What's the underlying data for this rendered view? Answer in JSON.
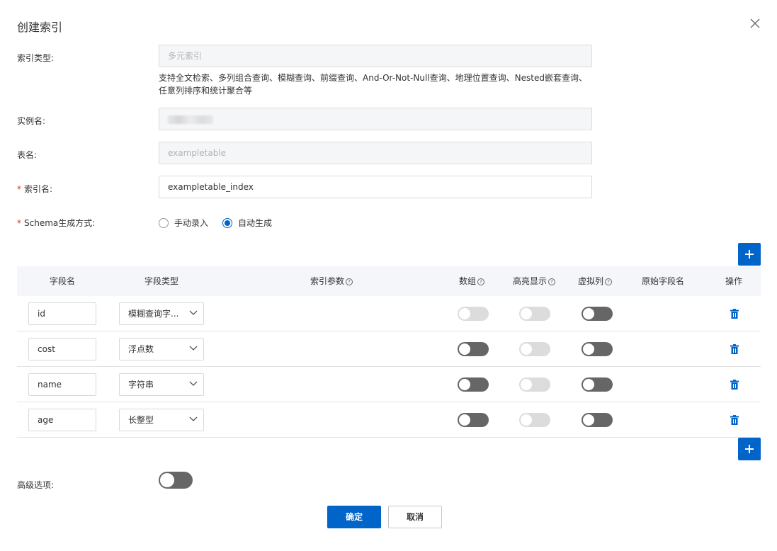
{
  "dialog": {
    "title": "创建索引",
    "close_icon": "close-icon"
  },
  "form": {
    "index_type": {
      "label": "索引类型:",
      "value": "多元索引",
      "description": "支持全文检索、多列组合查询、模糊查询、前缀查询、And-Or-Not-Null查询、地理位置查询、Nested嵌套查询、任意列排序和统计聚合等"
    },
    "instance": {
      "label": "实例名:"
    },
    "table": {
      "label": "表名:",
      "value": "exampletable"
    },
    "index_name": {
      "required": "*",
      "label": "索引名:",
      "value": "exampletable_index"
    },
    "schema_mode": {
      "required": "*",
      "label": "Schema生成方式:",
      "options": [
        "手动录入",
        "自动生成"
      ],
      "selected": "自动生成"
    }
  },
  "table": {
    "headers": {
      "field_name": "字段名",
      "field_type": "字段类型",
      "index_params": "索引参数",
      "array": "数组",
      "highlight": "高亮显示",
      "virtual": "虚拟列",
      "original_field": "原始字段名",
      "actions": "操作",
      "help_glyph": "?"
    },
    "rows": [
      {
        "name": "id",
        "type": "模糊查询字...",
        "array": false,
        "array_disabled": true,
        "highlight": false,
        "highlight_disabled": true,
        "virtual": false
      },
      {
        "name": "cost",
        "type": "浮点数",
        "array": false,
        "array_disabled": false,
        "highlight": false,
        "highlight_disabled": true,
        "virtual": false
      },
      {
        "name": "name",
        "type": "字符串",
        "array": false,
        "array_disabled": false,
        "highlight": false,
        "highlight_disabled": true,
        "virtual": false
      },
      {
        "name": "age",
        "type": "长整型",
        "array": false,
        "array_disabled": false,
        "highlight": false,
        "highlight_disabled": true,
        "virtual": false
      }
    ]
  },
  "advanced": {
    "label": "高级选项:",
    "enabled": false
  },
  "footer": {
    "confirm": "确定",
    "cancel": "取消"
  },
  "colors": {
    "primary": "#0064c8",
    "required": "#d93026",
    "switch_off": "#666666",
    "switch_disabled": "#dcdcdc"
  }
}
